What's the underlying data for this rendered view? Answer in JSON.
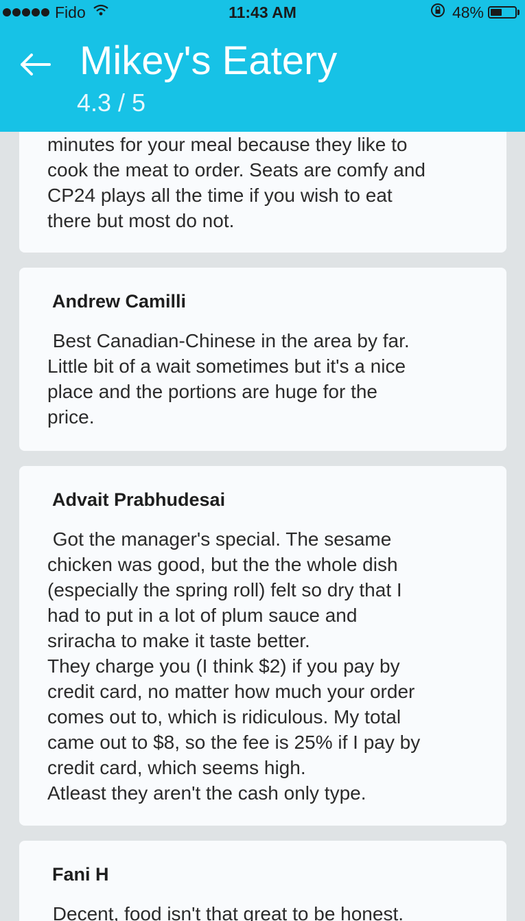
{
  "status_bar": {
    "carrier": "Fido",
    "time": "11:43 AM",
    "battery_percent": "48%",
    "battery_level": 0.48,
    "signal_bars": 5,
    "icons": [
      "wifi-icon",
      "orientation-lock-icon",
      "battery-icon"
    ]
  },
  "header": {
    "title": "Mikey's Eatery",
    "rating": "4.3 / 5",
    "back_icon": "back-arrow-icon",
    "background_color": "#17c2e6"
  },
  "reviews": [
    {
      "author": "",
      "text": "minutes for your meal because they like to\ncook the meat to order. Seats are comfy and\nCP24 plays all the time if you wish to eat\nthere but most do not."
    },
    {
      "author": "Andrew Camilli",
      "text": " Best Canadian-Chinese in the area by far.\nLittle bit of a wait sometimes but it's a nice\nplace and the portions are huge for the\nprice."
    },
    {
      "author": "Advait Prabhudesai",
      "text": " Got the manager's special. The sesame\nchicken was good, but the the whole dish\n(especially the spring roll) felt so dry that I\nhad to put in a lot of plum sauce and\nsriracha to make it taste better.\nThey charge you (I think $2) if you pay by\ncredit card, no matter how much your order\ncomes out to, which is ridiculous. My total\ncame out to $8, so the fee is 25% if I pay by\ncredit card, which seems high.\nAtleast they aren't the cash only type."
    },
    {
      "author": "Fani H",
      "text": " Decent, food isn't that great to be honest."
    }
  ]
}
